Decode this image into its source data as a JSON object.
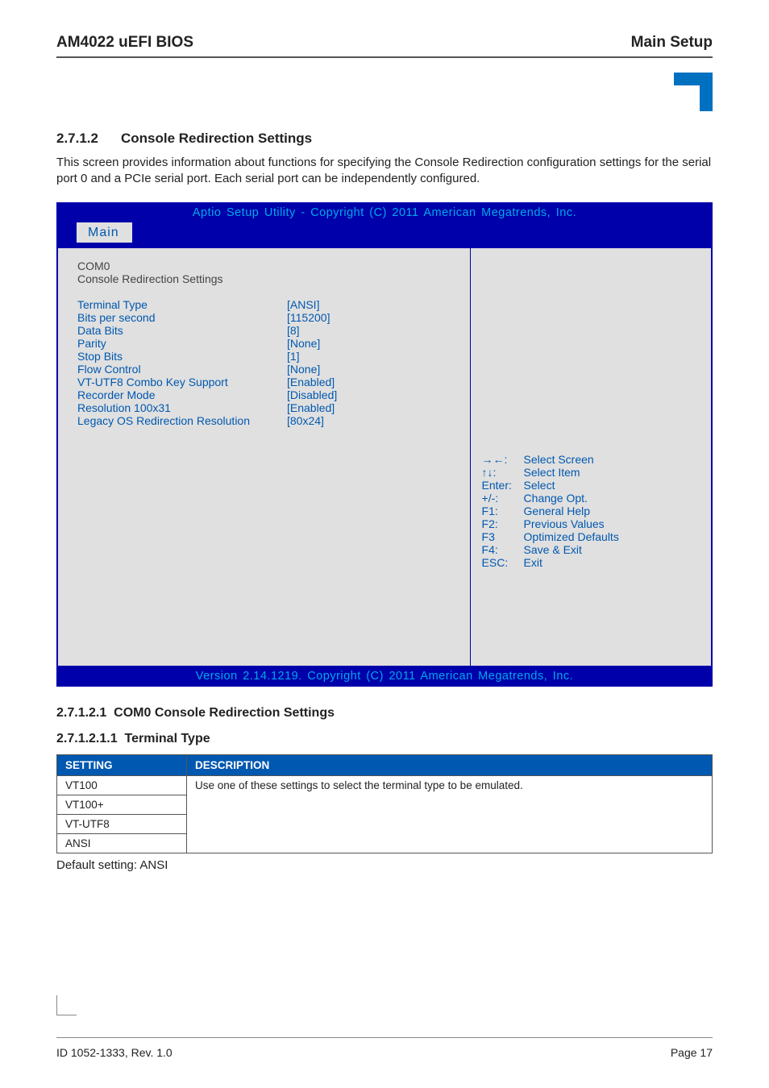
{
  "header": {
    "left": "AM4022 uEFI BIOS",
    "right": "Main Setup"
  },
  "section": {
    "number": "2.7.1.2",
    "title": "Console Redirection Settings",
    "paragraph": "This screen provides information about functions for specifying the Console Redirection configuration settings for the serial port 0 and a PCIe serial port. Each serial port can be independently configured."
  },
  "bios": {
    "topbar": "Aptio Setup Utility  -  Copyright  (C)  2011 American Megatrends, Inc.",
    "tab": "Main",
    "static_lines": [
      "COM0",
      "Console Redirection Settings"
    ],
    "options": [
      {
        "label": "Terminal Type",
        "value": "[ANSI]"
      },
      {
        "label": "Bits per second",
        "value": "[115200]"
      },
      {
        "label": "Data Bits",
        "value": "[8]"
      },
      {
        "label": "Parity",
        "value": "[None]"
      },
      {
        "label": "Stop Bits",
        "value": "[1]"
      },
      {
        "label": "Flow Control",
        "value": "[None]"
      },
      {
        "label": "VT-UTF8 Combo Key Support",
        "value": "[Enabled]"
      },
      {
        "label": "Recorder Mode",
        "value": "[Disabled]"
      },
      {
        "label": "Resolution 100x31",
        "value": "[Enabled]"
      },
      {
        "label": "Legacy OS Redirection Resolution",
        "value": "[80x24]"
      }
    ],
    "legend": [
      {
        "key": "→←:",
        "desc": "Select Screen"
      },
      {
        "key": "↑↓:",
        "desc": "Select Item"
      },
      {
        "key": "Enter:",
        "desc": "Select"
      },
      {
        "key": "+/-:",
        "desc": "Change Opt."
      },
      {
        "key": "F1:",
        "desc": "General Help"
      },
      {
        "key": "F2:",
        "desc": "Previous Values"
      },
      {
        "key": "F3",
        "desc": "Optimized Defaults"
      },
      {
        "key": "F4:",
        "desc": "Save & Exit"
      },
      {
        "key": "ESC:",
        "desc": "Exit"
      }
    ],
    "bottombar": "Version  2.14.1219.  Copyright  (C)  2011  American  Megatrends,  Inc."
  },
  "subsection1": {
    "num": "2.7.1.2.1",
    "title": "COM0 Console Redirection Settings"
  },
  "subsection2": {
    "num": "2.7.1.2.1.1",
    "title": "Terminal Type"
  },
  "table": {
    "headers": {
      "setting": "SETTING",
      "description": "DESCRIPTION"
    },
    "desc": "Use one of these settings to select the terminal type to be emulated.",
    "rows": [
      "VT100",
      "VT100+",
      "VT-UTF8",
      "ANSI"
    ]
  },
  "default_note": "Default setting: ANSI",
  "footer": {
    "left": "ID 1052-1333, Rev. 1.0",
    "right": "Page 17"
  }
}
